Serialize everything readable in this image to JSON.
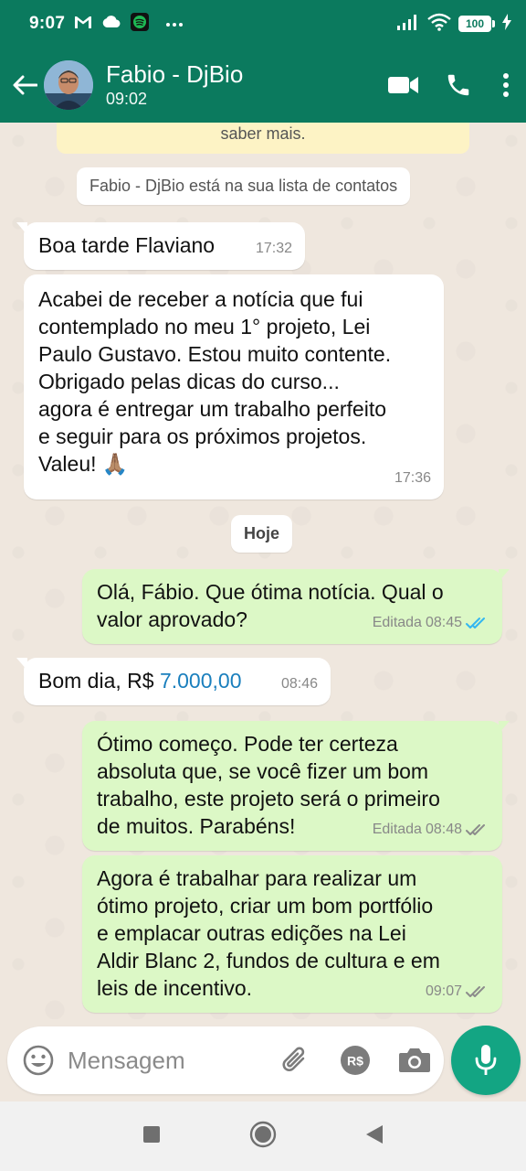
{
  "status_bar": {
    "time": "9:07",
    "battery": "100",
    "icons": [
      "gmail-icon",
      "cloud-icon",
      "spotify-icon",
      "more-dots-icon",
      "signal-icon",
      "wifi-icon",
      "battery-icon",
      "charging-icon"
    ]
  },
  "header": {
    "contact_name": "Fabio - DjBio",
    "last_seen": "09:02",
    "actions": [
      "video-call-icon",
      "voice-call-icon",
      "more-vert-icon"
    ]
  },
  "chat": {
    "banner_text": "saber mais.",
    "contact_notice": "Fabio - DjBio está na sua lista de contatos",
    "date_separator": "Hoje",
    "messages": [
      {
        "direction": "in",
        "text": "Boa tarde Flaviano",
        "time": "17:32"
      },
      {
        "direction": "in",
        "text": "Acabei de receber a notícia que fui\ncontemplado no meu 1° projeto, Lei\nPaulo Gustavo. Estou muito contente.\nObrigado pelas dicas do curso...\nagora é entregar um trabalho perfeito\ne seguir para os próximos projetos.\nValeu! 🙏🏽",
        "time": "17:36"
      },
      {
        "direction": "out",
        "text": "Olá, Fábio. Que ótima notícia. Qual o\nvalor aprovado?",
        "edited_label": "Editada",
        "time": "08:45",
        "status": "read"
      },
      {
        "direction": "in",
        "text_prefix": "Bom dia, R$ ",
        "text_link": "7.000,00",
        "time": "08:46"
      },
      {
        "direction": "out",
        "text": "Ótimo começo. Pode ter certeza\nabsoluta que, se você fizer um bom\ntrabalho, este projeto será o primeiro\nde muitos. Parabéns!",
        "edited_label": "Editada",
        "time": "08:48",
        "status": "delivered"
      },
      {
        "direction": "out",
        "text": "Agora é trabalhar para realizar um\nótimo projeto, criar um bom portfólio\ne emplacar outras edições na Lei\nAldir Blanc 2, fundos de cultura e em\nleis de incentivo.",
        "time": "09:07",
        "status": "delivered"
      }
    ]
  },
  "composer": {
    "placeholder": "Mensagem"
  },
  "colors": {
    "header": "#0b7a5e",
    "outgoing_bubble": "#dcf8c6",
    "incoming_bubble": "#ffffff",
    "mic_button": "#13a583",
    "read_ticks": "#34b7f1",
    "link": "#1a7fbd"
  }
}
